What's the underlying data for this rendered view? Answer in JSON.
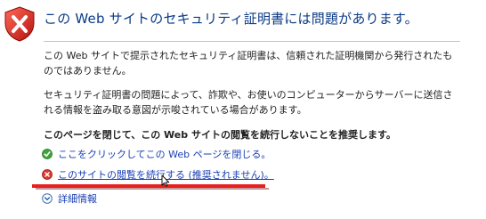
{
  "header": {
    "title": "この Web サイトのセキュリティ証明書には問題があります。",
    "icon": "security-warning-shield-icon"
  },
  "body": {
    "paragraph1": "この Web サイトで提示されたセキュリティ証明書は、信頼された証明機関から発行されたものではありません。",
    "paragraph2": "セキュリティ証明書の問題によって、詐欺や、お使いのコンピューターからサーバーに送信される情報を盗み取る意図が示唆されている場合があります。",
    "recommendation": "このページを閉じて、この Web サイトの閲覧を続行しないことを推奨します。"
  },
  "options": {
    "close_page": "ここをクリックしてこの Web ページを閉じる。",
    "continue_site": "このサイトの閲覧を続行する (推奨されません)。",
    "more_info": "詳細情報"
  },
  "colors": {
    "title": "#0a3a86",
    "link": "#1a3fb4",
    "annotation_red": "#e81f1f"
  }
}
